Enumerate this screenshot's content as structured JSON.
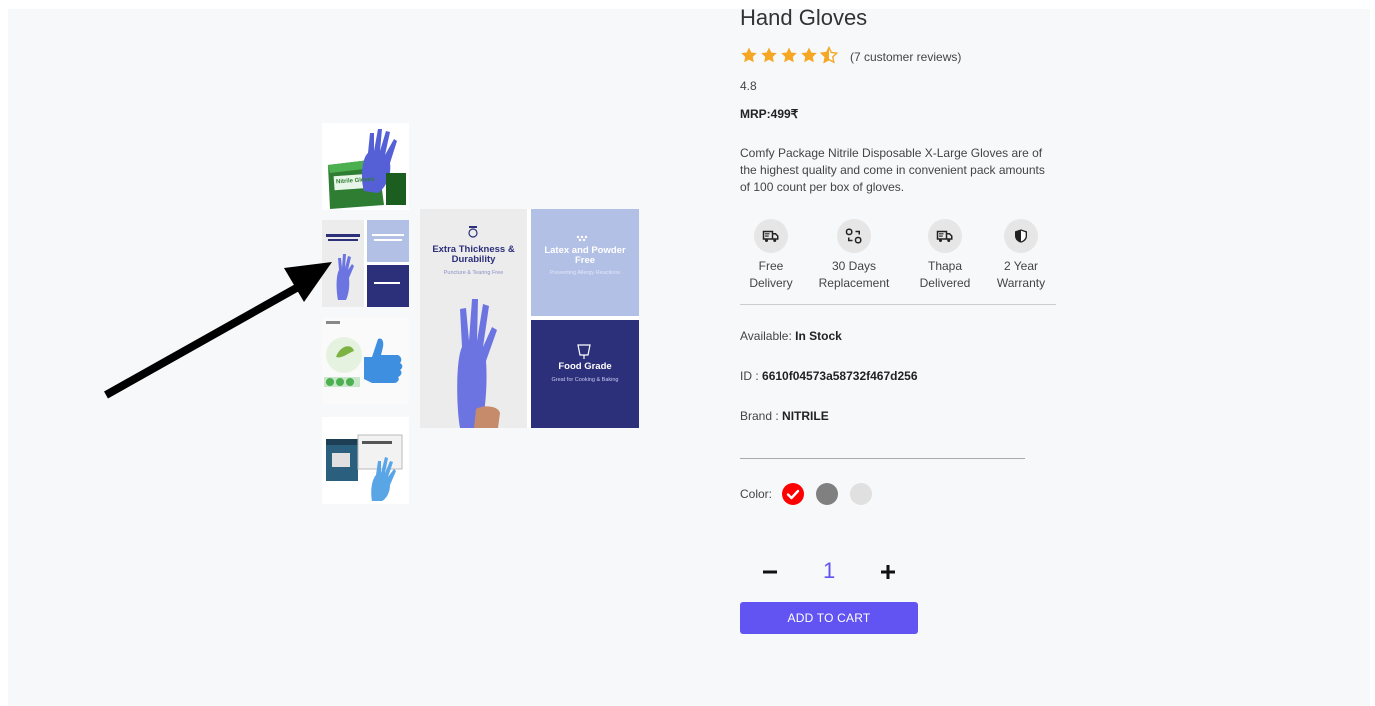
{
  "product": {
    "title": "Hand Gloves",
    "rating_stars": 4.5,
    "reviews_text": "(7 customer reviews)",
    "rating_value": "4.8",
    "mrp": "MRP:499₹",
    "description": "Comfy Package Nitrile Disposable X-Large Gloves are of the highest quality and come in convenient pack amounts of 100 count per box of gloves."
  },
  "features": [
    {
      "line1": "Free",
      "line2": "Delivery",
      "icon": "truck-icon"
    },
    {
      "line1": "30 Days",
      "line2": "Replacement",
      "icon": "replacement-icon"
    },
    {
      "line1": "Thapa",
      "line2": "Delivered",
      "icon": "delivery-truck-icon"
    },
    {
      "line1": "2 Year",
      "line2": "Warranty",
      "icon": "shield-icon"
    }
  ],
  "info": {
    "available_label": "Available:",
    "available_value": "In Stock",
    "id_label": "ID :",
    "id_value": "6610f04573a58732f467d256",
    "brand_label": "Brand :",
    "brand_value": "NITRILE"
  },
  "colors": {
    "label": "Color:",
    "swatches": [
      "#ff0000",
      "#808080",
      "#e0e0e0"
    ],
    "selected": 0
  },
  "quantity": {
    "value": "1"
  },
  "cart_button": "ADD TO CART",
  "main_image": {
    "panel1_title": "Extra Thickness & Durability",
    "panel1_sub": "Puncture & Tearing Free",
    "panel2_title": "Latex and Powder Free",
    "panel2_sub": "Preventing Allergy Reactions",
    "panel3_title": "Food Grade",
    "panel3_sub": "Great for Cooking & Baking"
  },
  "thumbnails": {
    "box_label": "Nitrile Gloves"
  },
  "colors_theme": {
    "accent": "#6254f3",
    "star": "#f5a623"
  }
}
